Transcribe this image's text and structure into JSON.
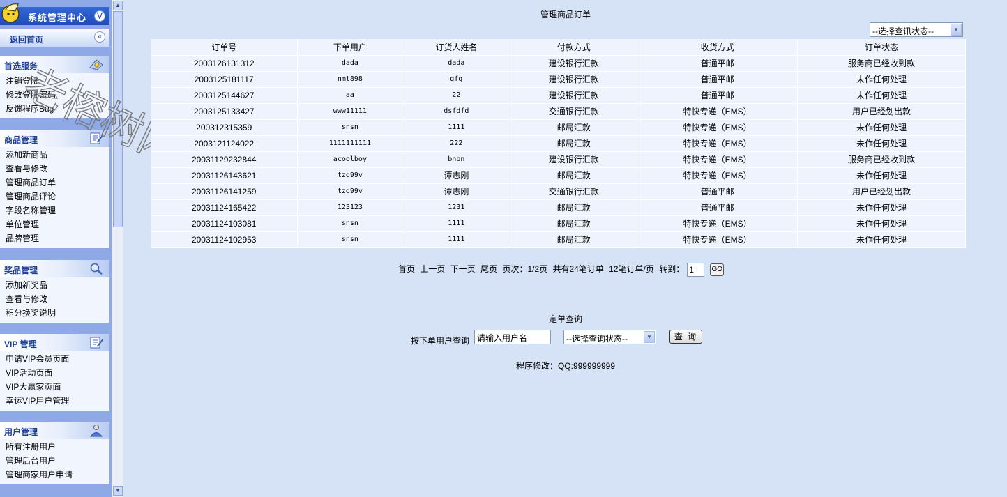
{
  "sidebar": {
    "title": "系统管理中心",
    "back_home": "返回首页",
    "sections": [
      {
        "title": "首选服务",
        "icon": "services-icon",
        "items": [
          "注销登陆",
          "修改登陆密码",
          "反馈程序Bug"
        ]
      },
      {
        "title": "商品管理",
        "icon": "edit-note-icon",
        "items": [
          "添加新商品",
          "查看与修改",
          "管理商品订单",
          "管理商品评论",
          "字段名称管理",
          "单位管理",
          "品牌管理"
        ]
      },
      {
        "title": "奖品管理",
        "icon": "magnifier-icon",
        "items": [
          "添加新奖品",
          "查看与修改",
          "积分换奖说明"
        ]
      },
      {
        "title": "VIP 管理",
        "icon": "edit-note-icon",
        "items": [
          "申请VIP会员页面",
          "VIP活动页面",
          "VIP大赢家页面",
          "幸运VIP用户管理"
        ]
      },
      {
        "title": "用户管理",
        "icon": "user-icon",
        "items": [
          "所有注册用户",
          "管理后台用户",
          "管理商家用户申请"
        ]
      }
    ]
  },
  "watermark": "老榕树网络",
  "page": {
    "title": "管理商品订单",
    "status_select_top": "--选择查讯状态--"
  },
  "table": {
    "headers": [
      "订单号",
      "下单用户",
      "订货人姓名",
      "付款方式",
      "收货方式",
      "订单状态"
    ],
    "rows": [
      [
        "2003126131312",
        "dada",
        "dada",
        "建设银行汇款",
        "普通平邮",
        "服务商已经收到款"
      ],
      [
        "2003125181117",
        "nmt898",
        "gfg",
        "建设银行汇款",
        "普通平邮",
        "未作任何处理"
      ],
      [
        "2003125144627",
        "aa",
        "22",
        "建设银行汇款",
        "普通平邮",
        "未作任何处理"
      ],
      [
        "2003125133427",
        "www11111",
        "dsfdfd",
        "交通银行汇款",
        "特快专递（EMS）",
        "用户已经划出款"
      ],
      [
        "200312315359",
        "snsn",
        "1111",
        "邮局汇款",
        "特快专递（EMS）",
        "未作任何处理"
      ],
      [
        "2003121124022",
        "1111111111",
        "222",
        "邮局汇款",
        "特快专递（EMS）",
        "未作任何处理"
      ],
      [
        "20031129232844",
        "acoolboy",
        "bnbn",
        "建设银行汇款",
        "特快专递（EMS）",
        "服务商已经收到款"
      ],
      [
        "20031126143621",
        "tzg99v",
        "谭志刚",
        "邮局汇款",
        "特快专递（EMS）",
        "未作任何处理"
      ],
      [
        "20031126141259",
        "tzg99v",
        "谭志刚",
        "交通银行汇款",
        "普通平邮",
        "用户已经划出款"
      ],
      [
        "20031124165422",
        "123123",
        "1231",
        "邮局汇款",
        "普通平邮",
        "未作任何处理"
      ],
      [
        "20031124103081",
        "snsn",
        "1111",
        "邮局汇款",
        "特快专递（EMS）",
        "未作任何处理"
      ],
      [
        "20031124102953",
        "snsn",
        "1111",
        "邮局汇款",
        "特快专递（EMS）",
        "未作任何处理"
      ]
    ]
  },
  "pager": {
    "first": "首页",
    "prev": "上一页",
    "next": "下一页",
    "last": "尾页",
    "page_info": "页次：1/2页",
    "total_info": "共有24笔订单",
    "per_page": "12笔订单/页",
    "goto_label": "转到：",
    "goto_value": "1",
    "go_label": "GO"
  },
  "query": {
    "title": "定单查询",
    "label": "按下单用户查询",
    "input_value": "请输入用户名",
    "status_select": "--选择查询状态--",
    "button": "查 询"
  },
  "footer": {
    "credit": "程序修改：QQ:999999999"
  },
  "colors": {
    "page_bg": "#d6e3f7",
    "sidebar_bg": "#8fa9e6",
    "brand_bar": "#2a5bc8",
    "section_title": "#1d3f95",
    "table_bg": "#eef3fd",
    "watermark": "#7a7a7a"
  }
}
